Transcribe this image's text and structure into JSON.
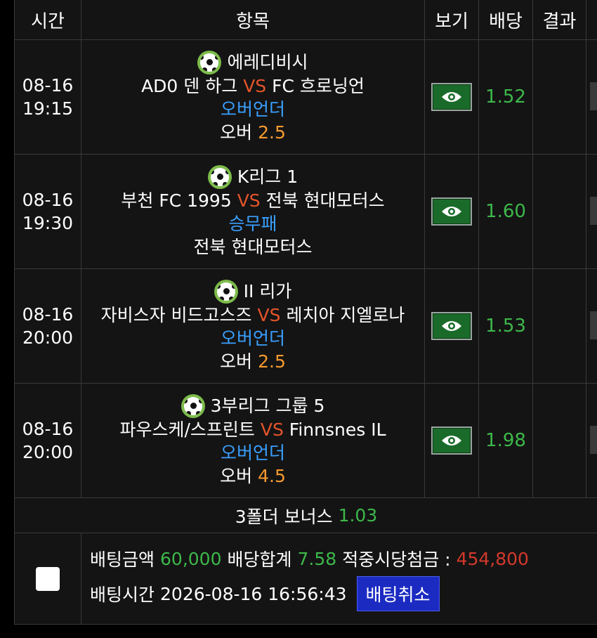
{
  "header": {
    "time": "시간",
    "item": "항목",
    "view": "보기",
    "odds": "배당",
    "result": "결과"
  },
  "bets": [
    {
      "date": "08-16",
      "clock": "19:15",
      "league": "에레디비시",
      "home": "AD0 덴 하그",
      "vs": "VS",
      "away": "FC 흐로닝언",
      "market": "오버언더",
      "pick_text": "오버",
      "pick_num": "2.5",
      "odds": "1.52"
    },
    {
      "date": "08-16",
      "clock": "19:30",
      "league": "K리그 1",
      "home": "부천 FC 1995",
      "vs": "VS",
      "away": "전북 현대모터스",
      "market": "승무패",
      "pick_text": "전북 현대모터스",
      "pick_num": "",
      "odds": "1.60"
    },
    {
      "date": "08-16",
      "clock": "20:00",
      "league": "II 리가",
      "home": "자비스자 비드고스즈",
      "vs": "VS",
      "away": "레치아 지엘로나",
      "market": "오버언더",
      "pick_text": "오버",
      "pick_num": "2.5",
      "odds": "1.53"
    },
    {
      "date": "08-16",
      "clock": "20:00",
      "league": "3부리그 그룹 5",
      "home": "파우스케/스프린트",
      "vs": "VS",
      "away": "Finnsnes IL",
      "market": "오버언더",
      "pick_text": "오버",
      "pick_num": "4.5",
      "odds": "1.98"
    }
  ],
  "bonus": {
    "label": "3폴더 보너스",
    "value": "1.03"
  },
  "summary": {
    "stake_label": "배팅금액",
    "stake": "60,000",
    "total_odds_label": "배당합계",
    "total_odds": "7.58",
    "payout_label": "적중시당첨금 :",
    "payout": "454,800",
    "time_label": "배팅시간",
    "time": "2026-08-16 16:56:43",
    "cancel_label": "배팅취소"
  },
  "colors": {
    "vs": "#e4542a",
    "market": "#3aa0ff",
    "pick_number": "#f59a2e",
    "odds": "#3db84a",
    "payout": "#d2392a",
    "cancel_button": "#1b2bc2"
  },
  "icons": {
    "league": "soccer-ball-icon",
    "view": "eye-icon"
  }
}
